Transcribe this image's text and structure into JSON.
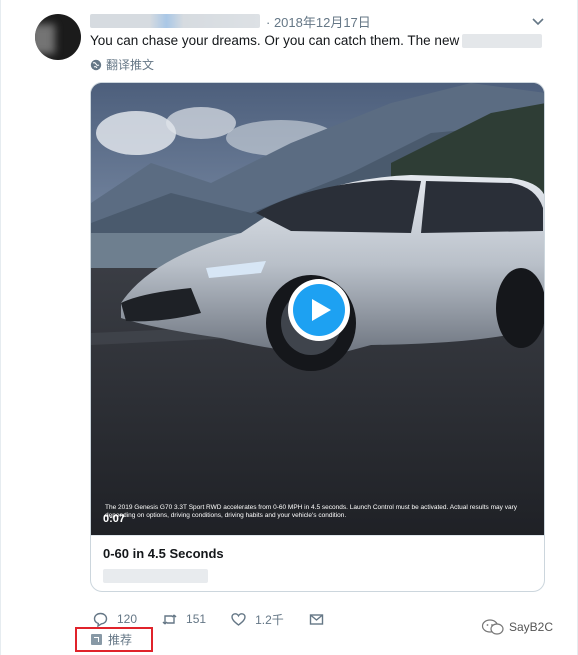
{
  "tweet": {
    "author_name": "",
    "date": "· 2018年12月17日",
    "text": "You can chase your dreams. Or you can catch them. The new",
    "translate_label": "翻译推文"
  },
  "video": {
    "disclaimer": "The 2019 Genesis G70 3.3T Sport RWD accelerates from 0-60 MPH in 4.5 seconds. Launch Control must be activated. Actual results may vary depending on options, driving conditions, driving habits and your vehicle's condition.",
    "duration": "0:07"
  },
  "card": {
    "title": "0-60 in 4.5 Seconds"
  },
  "actions": {
    "reply_count": "120",
    "retweet_count": "151",
    "like_count": "1.2千"
  },
  "promoted_label": "推荐",
  "watermark": "SayB2C",
  "icons": [
    "chevron-down-icon",
    "globe-icon",
    "play-icon",
    "reply-icon",
    "retweet-icon",
    "like-icon",
    "message-icon",
    "promoted-icon",
    "wechat-icon"
  ],
  "colors": {
    "accent": "#1da1f2",
    "text_secondary": "#657786",
    "highlight_border": "#e0232b"
  }
}
